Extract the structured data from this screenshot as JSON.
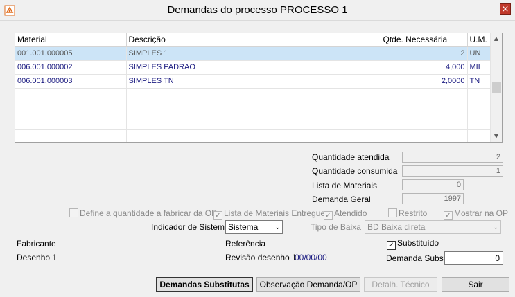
{
  "window": {
    "title": "Demandas do processo PROCESSO 1",
    "close_glyph": "×"
  },
  "grid": {
    "columns": [
      "Material",
      "Descrição",
      "Qtde. Necessária",
      "U.M."
    ],
    "rows": [
      {
        "material": "001.001.000005",
        "descricao": "SIMPLES 1",
        "qtde": "2",
        "um": "UN"
      },
      {
        "material": "006.001.000002",
        "descricao": "SIMPLES PADRAO",
        "qtde": "4,000",
        "um": "MIL"
      },
      {
        "material": "006.001.000003",
        "descricao": "SIMPLES TN",
        "qtde": "2,0000",
        "um": "TN"
      }
    ],
    "selected_row_index": 0,
    "scroll_up_glyph": "▲",
    "scroll_down_glyph": "▼"
  },
  "fields": {
    "quantidade_atendida": {
      "label": "Quantidade atendida",
      "value": "2"
    },
    "quantidade_consumida": {
      "label": "Quantidade consumida",
      "value": "1"
    },
    "lista_materiais": {
      "label": "Lista de Materiais",
      "value": "0"
    },
    "demanda_geral": {
      "label": "Demanda Geral",
      "value": "1997"
    }
  },
  "checkboxes": {
    "define_quantidade": {
      "label": "Define a quantidade a fabricar da OP",
      "checked": false
    },
    "lista_entregue": {
      "label": "Lista de Materiais Entregue",
      "checked": true
    },
    "atendido": {
      "label": "Atendido",
      "checked": true
    },
    "restrito": {
      "label": "Restrito",
      "checked": false
    },
    "mostrar_op": {
      "label": "Mostrar na OP",
      "checked": true
    },
    "substituido": {
      "label": "Substituído",
      "checked": true
    },
    "check_glyph": "✓"
  },
  "indicador": {
    "label": "Indicador de Sistema",
    "value": "Sistema"
  },
  "tipo_baixa": {
    "label": "Tipo de Baixa",
    "value": "BD Baixa direta"
  },
  "dropdown_glyph": "⌄",
  "info": {
    "fabricante": "Fabricante",
    "desenho": "Desenho 1",
    "referencia": "Referência",
    "revisao_label": "Revisão desenho 1",
    "revisao_value": "00/00/00",
    "demanda_subst_label": "Demanda Subst.",
    "demanda_subst_value": "0"
  },
  "buttons": {
    "demandas_substitutas": "Demandas Substitutas",
    "observacao": "Observação Demanda/OP",
    "detalhe_tecnico": "Detalh. Técnico",
    "sair": "Sair"
  },
  "colors": {
    "selection": "#cce4f7",
    "row_text": "#1a1a80",
    "close": "#c0392b"
  }
}
